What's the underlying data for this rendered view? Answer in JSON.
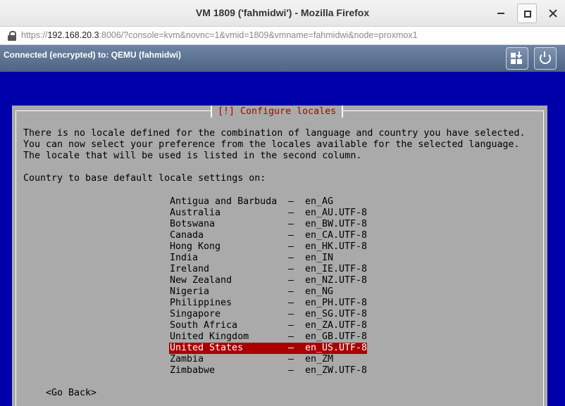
{
  "window": {
    "title": "VM 1809 ('fahmidwi') - Mozilla Firefox"
  },
  "browser": {
    "url_scheme": "https://",
    "url_host": "192.168.20.3",
    "url_rest": ":8006/?console=kvm&novnc=1&vmid=1809&vmname=fahmidwi&node=proxmox1"
  },
  "vnc": {
    "status": "Connected (encrypted) to: QEMU (fahmidwi)",
    "buttons": [
      "send-keys-icon",
      "power-icon"
    ]
  },
  "installer": {
    "title": "[!] Configure locales",
    "description": [
      "There is no locale defined for the combination of language and country you have selected.",
      "You can now select your preference from the locales available for the selected language.",
      "The locale that will be used is listed in the second column."
    ],
    "prompt": "Country to base default locale settings on:",
    "separator": "–",
    "locales": [
      {
        "country": "Antigua and Barbuda",
        "code": "en_AG",
        "selected": false
      },
      {
        "country": "Australia",
        "code": "en_AU.UTF-8",
        "selected": false
      },
      {
        "country": "Botswana",
        "code": "en_BW.UTF-8",
        "selected": false
      },
      {
        "country": "Canada",
        "code": "en_CA.UTF-8",
        "selected": false
      },
      {
        "country": "Hong Kong",
        "code": "en_HK.UTF-8",
        "selected": false
      },
      {
        "country": "India",
        "code": "en_IN",
        "selected": false
      },
      {
        "country": "Ireland",
        "code": "en_IE.UTF-8",
        "selected": false
      },
      {
        "country": "New Zealand",
        "code": "en_NZ.UTF-8",
        "selected": false
      },
      {
        "country": "Nigeria",
        "code": "en_NG",
        "selected": false
      },
      {
        "country": "Philippines",
        "code": "en_PH.UTF-8",
        "selected": false
      },
      {
        "country": "Singapore",
        "code": "en_SG.UTF-8",
        "selected": false
      },
      {
        "country": "South Africa",
        "code": "en_ZA.UTF-8",
        "selected": false
      },
      {
        "country": "United Kingdom",
        "code": "en_GB.UTF-8",
        "selected": false
      },
      {
        "country": "United States",
        "code": "en_US.UTF-8",
        "selected": true
      },
      {
        "country": "Zambia",
        "code": "en_ZM",
        "selected": false
      },
      {
        "country": "Zimbabwe",
        "code": "en_ZW.UTF-8",
        "selected": false
      }
    ],
    "go_back": "<Go Back>"
  },
  "colors": {
    "console_bg": "#0000aa",
    "dialog_bg": "#aaaaaa",
    "dialog_title": "#aa0000",
    "selection_bg": "#aa0000"
  }
}
